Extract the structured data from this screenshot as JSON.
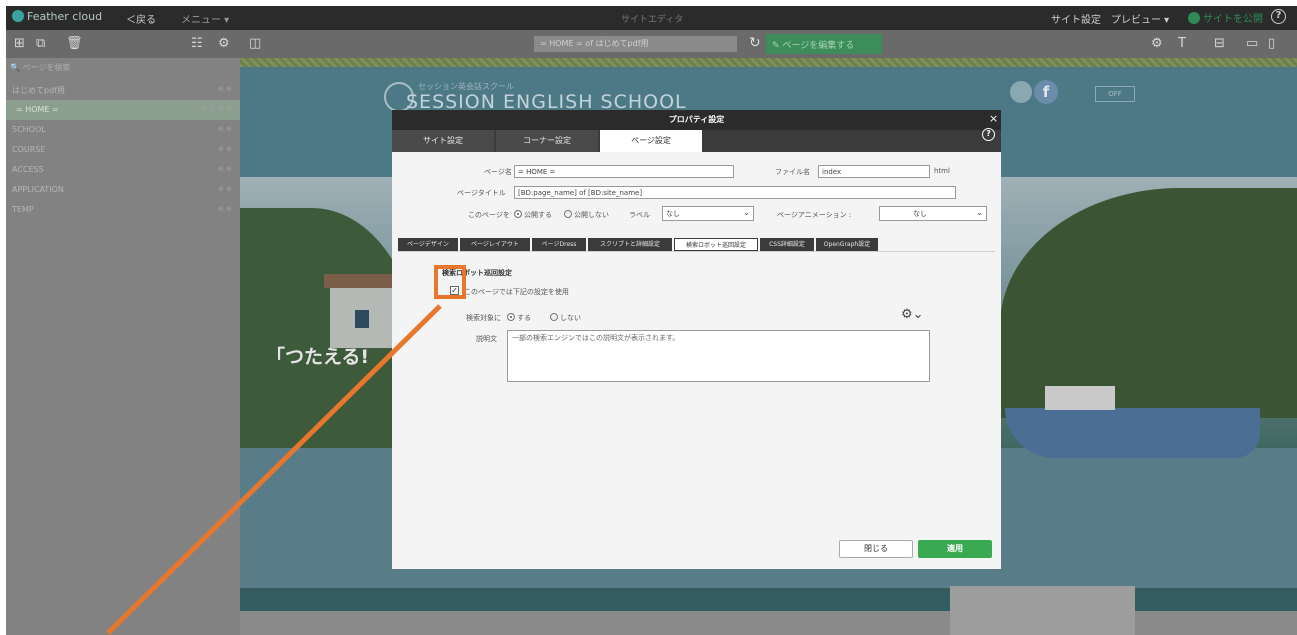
{
  "topbar": {
    "logo_text": "Feather cloud",
    "back_label": "＜戻る",
    "menu_label": "メニュー ▾",
    "center_title": "サイトエディタ",
    "site_settings": "サイト設定",
    "preview": "プレビュー ▾",
    "publish": "サイトを公開",
    "help": "?"
  },
  "toolbar": {
    "url_text": "= HOME = of はじめてpdf用",
    "edit_button": "ページを編集する"
  },
  "sidebar": {
    "search_placeholder": "ページを検索",
    "items": [
      {
        "label": "はじめてpdf用",
        "actions": "⊕ ⊕"
      },
      {
        "label": "= HOME =",
        "actions": "⊖ ⊙ ⊕ ⊕"
      },
      {
        "label": "SCHOOL",
        "actions": "⊕ ⊕"
      },
      {
        "label": "COURSE",
        "actions": "⊕ ⊕"
      },
      {
        "label": "ACCESS",
        "actions": "⊕ ⊕"
      },
      {
        "label": "APPLICATION",
        "actions": "⊕ ⊕"
      },
      {
        "label": "TEMP",
        "actions": "⊕ ⊕"
      }
    ]
  },
  "preview": {
    "school_sub": "セッション英会話スクール",
    "school_name": "SESSION ENGLISH SCHOOL",
    "fb": "f",
    "off_label": "OFF",
    "catch": "「つたえる!"
  },
  "dialog": {
    "title": "プロパティ設定",
    "close": "×",
    "help": "?",
    "tabs": [
      "サイト設定",
      "コーナー設定",
      "ページ設定"
    ],
    "page_name_label": "ページ名",
    "page_name_value": "= HOME =",
    "file_name_label": "ファイル名",
    "file_name_value": "index",
    "file_ext": "html",
    "page_title_label": "ページタイトル",
    "page_title_value": "[BD:page_name] of [BD:site_name]",
    "publish_label": "このページを",
    "publish_on": "公開する",
    "publish_off": "公開しない",
    "label_label": "ラベル",
    "label_value": "なし",
    "animation_label": "ページアニメーション :",
    "animation_value": "なし",
    "subtabs": [
      "ページデザイン",
      "ページレイアウト",
      "ページDress",
      "スクリプトと詳細設定",
      "検索ロボット巡回設定",
      "CSS詳細設定",
      "OpenGraph設定"
    ],
    "section_title": "検索ロボット巡回設定",
    "checkbox_label": "このページでは下記の設定を使用",
    "search_target_label": "検索対象に",
    "search_target_on": "する",
    "search_target_off": "しない",
    "description_label": "説明文",
    "description_value": "一部の検索エンジンではこの説明文が表示されます。",
    "close_button": "閉じる",
    "apply_button": "適用"
  },
  "colors": {
    "accent_green": "#3aaa52",
    "annotation_orange": "#e8772e",
    "topbar_bg": "#2b2b2b"
  }
}
